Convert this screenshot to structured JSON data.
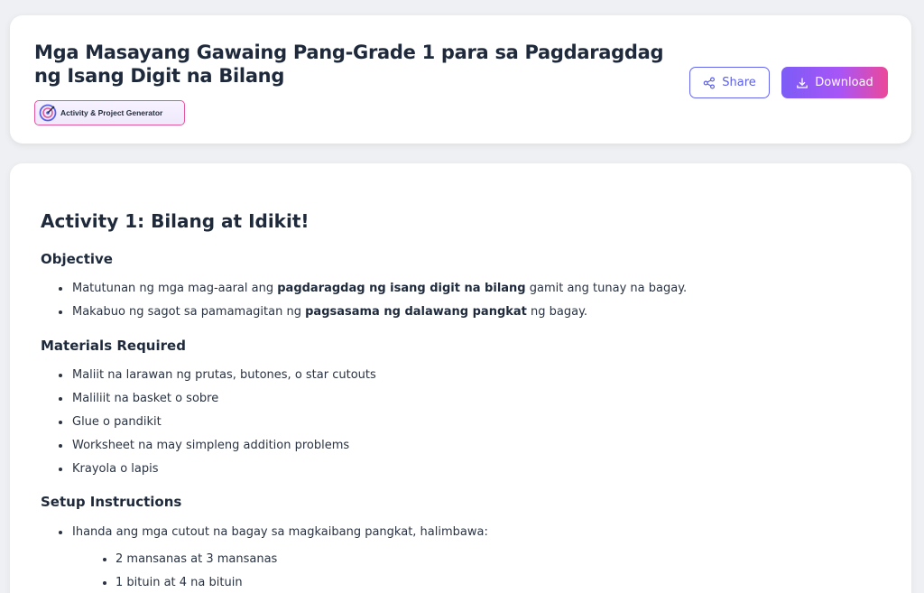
{
  "header": {
    "title": "Mga Masayang Gawaing Pang-Grade 1 para sa Pagdaragdag ng Isang Digit na Bilang",
    "badge_label": "Activity & Project Generator",
    "share_label": "Share",
    "download_label": "Download"
  },
  "activity": {
    "title": "Activity 1: Bilang at Idikit!",
    "objective": {
      "heading": "Objective",
      "items": [
        {
          "before": "Matutunan ng mga mag-aaral ang ",
          "bold": "pagdaragdag ng isang digit na bilang",
          "after": " gamit ang tunay na bagay."
        },
        {
          "before": "Makabuo ng sagot sa pamamagitan ng ",
          "bold": "pagsasama ng dalawang pangkat",
          "after": " ng bagay."
        }
      ]
    },
    "materials": {
      "heading": "Materials Required",
      "items": [
        "Maliit na larawan ng prutas, butones, o star cutouts",
        "Maliliit na basket o sobre",
        "Glue o pandikit",
        "Worksheet na may simpleng addition problems",
        "Krayola o lapis"
      ]
    },
    "setup": {
      "heading": "Setup Instructions",
      "items": [
        "Ihanda ang mga cutout na bagay sa magkaibang pangkat, halimbawa:"
      ],
      "sub_items": [
        "2 mansanas at 3 mansanas",
        "1 bituin at 4 na bituin"
      ]
    }
  },
  "colors": {
    "accent": "#6366f1",
    "gradient_start": "#7c5cf6",
    "gradient_end": "#ec4899"
  },
  "icons": {
    "badge": "target-arrow-icon",
    "share": "share-icon",
    "download": "download-icon"
  }
}
